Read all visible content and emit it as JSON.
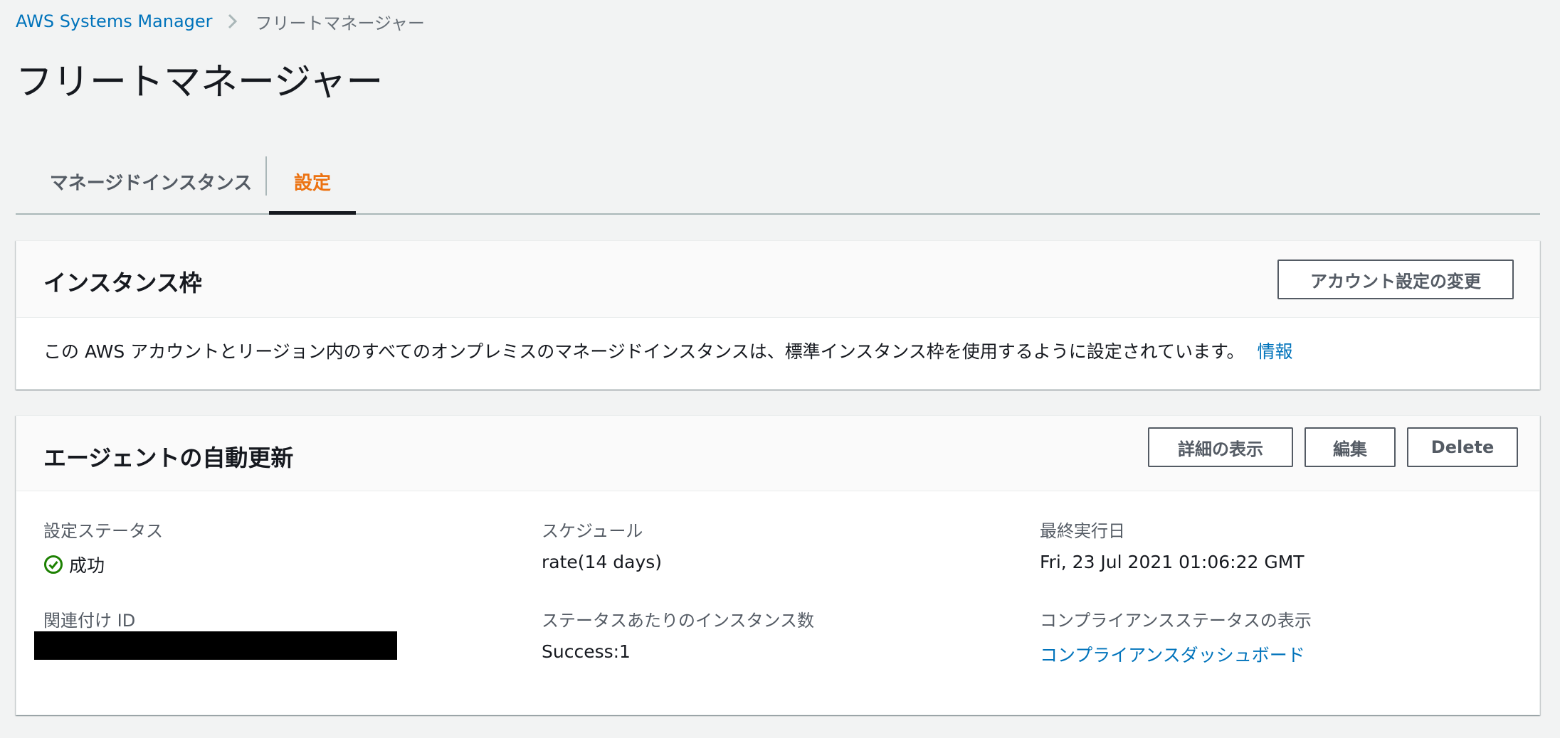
{
  "colors": {
    "link": "#0073bb",
    "active_tab": "#ec7211",
    "success": "#1d8102",
    "page_background": "#f2f3f3"
  },
  "breadcrumb": {
    "root": "AWS Systems Manager",
    "separator_icon": "chevron-right-icon",
    "current": "フリートマネージャー"
  },
  "page_title": "フリートマネージャー",
  "tabs": [
    {
      "label": "マネージドインスタンス",
      "active": false
    },
    {
      "label": "設定",
      "active": true
    }
  ],
  "instance_tier": {
    "title": "インスタンス枠",
    "button_label": "アカウント設定の変更",
    "description": "この AWS アカウントとリージョン内のすべてのオンプレミスのマネージドインスタンスは、標準インスタンス枠を使用するように設定されています。",
    "info_link": "情報"
  },
  "agent_auto_update": {
    "title": "エージェントの自動更新",
    "buttons": {
      "view_details": "詳細の表示",
      "edit": "編集",
      "delete": "Delete"
    },
    "fields": {
      "config_status_label": "設定ステータス",
      "config_status_value": "成功",
      "config_status_icon": "check-circle-icon",
      "schedule_label": "スケジュール",
      "schedule_value": "rate(14 days)",
      "last_run_label": "最終実行日",
      "last_run_value": "Fri, 23 Jul 2021 01:06:22 GMT",
      "association_id_label": "関連付け ID",
      "instances_per_status_label": "ステータスあたりのインスタンス数",
      "instances_per_status_value": "Success:1",
      "compliance_label": "コンプライアンスステータスの表示",
      "compliance_link": "コンプライアンスダッシュボード"
    }
  }
}
